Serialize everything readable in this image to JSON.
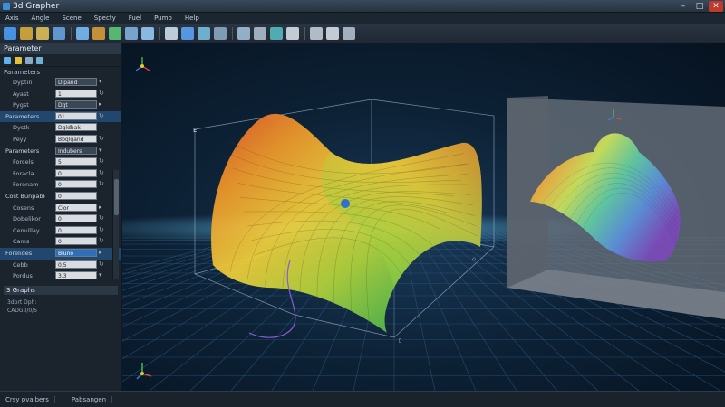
{
  "window": {
    "title": "3d Grapher"
  },
  "menu": [
    "Axis",
    "Angle",
    "Scene",
    "Specty",
    "Fuel",
    "Pump",
    "Help"
  ],
  "toolbar": {
    "tools": [
      {
        "icon": "new-file-icon",
        "color": "#4da3ff"
      },
      {
        "icon": "open-folder-icon",
        "color": "#e2b33c"
      },
      {
        "icon": "save-icon",
        "color": "#e8c85a"
      },
      {
        "icon": "copy-icon",
        "color": "#6aa9e8"
      },
      {
        "icon": "link-icon",
        "color": "#7fc3ff"
      },
      {
        "icon": "zoom-window-icon",
        "color": "#e3a13a"
      },
      {
        "icon": "draw-icon",
        "color": "#5fd07a"
      },
      {
        "icon": "rotate-icon",
        "color": "#86b9e8"
      },
      {
        "icon": "grab-icon",
        "color": "#9bd1ff"
      },
      {
        "icon": "zoom-icon",
        "color": "#d9e6f3"
      },
      {
        "icon": "arrow-down-icon",
        "color": "#5fa8ff"
      },
      {
        "icon": "layers-icon",
        "color": "#7cc6e8"
      },
      {
        "icon": "camera-icon",
        "color": "#8fb0c9"
      },
      {
        "icon": "grid-icon",
        "color": "#a7c7e0"
      },
      {
        "icon": "texture-icon",
        "color": "#b5c4d3"
      },
      {
        "icon": "triangle-icon",
        "color": "#58c2c8"
      },
      {
        "icon": "axes-icon",
        "color": "#dfe8f1"
      },
      {
        "icon": "compass-icon",
        "color": "#c9d5e0"
      },
      {
        "icon": "pointer-icon",
        "color": "#dfe8f1"
      },
      {
        "icon": "brush-icon",
        "color": "#b7c6d6"
      }
    ]
  },
  "panel": {
    "title": "Parameter",
    "section": "Parameters",
    "rows": [
      {
        "label": "Dyptin",
        "value": "Dlpand",
        "ctl": "▾",
        "style": "dark",
        "group": false,
        "hl": false
      },
      {
        "label": "Ayast",
        "value": "1",
        "ctl": "↻",
        "style": "light",
        "group": false,
        "hl": false
      },
      {
        "label": "Pygst",
        "value": "Dgt",
        "ctl": "▸",
        "style": "dark",
        "group": false,
        "hl": false
      },
      {
        "label": "Parameters",
        "value": "01",
        "ctl": "↻",
        "style": "light",
        "group": true,
        "hl": true
      },
      {
        "label": "Dystk",
        "value": "Dgldbak",
        "ctl": "",
        "style": "light",
        "group": false,
        "hl": false
      },
      {
        "label": "Peyy",
        "value": "Bbqlgand",
        "ctl": "↻",
        "style": "light",
        "group": false,
        "hl": false
      },
      {
        "label": "Parameters",
        "value": "Indubers",
        "ctl": "▾",
        "style": "dark",
        "group": true,
        "hl": false
      },
      {
        "label": "Forcels",
        "value": "5",
        "ctl": "↻",
        "style": "light",
        "group": false,
        "hl": false
      },
      {
        "label": "Foracla",
        "value": "0",
        "ctl": "↻",
        "style": "light",
        "group": false,
        "hl": false
      },
      {
        "label": "Forenam",
        "value": "0",
        "ctl": "↻",
        "style": "light",
        "group": false,
        "hl": false
      },
      {
        "label": "Cost Bunpable",
        "value": "0",
        "ctl": "",
        "style": "light",
        "group": true,
        "hl": false
      },
      {
        "label": "Cosens",
        "value": "Clor",
        "ctl": "▸",
        "style": "light",
        "group": false,
        "hl": false
      },
      {
        "label": "Dobelikor",
        "value": "0",
        "ctl": "↻",
        "style": "light",
        "group": false,
        "hl": false
      },
      {
        "label": "Cenvillay",
        "value": "0",
        "ctl": "↻",
        "style": "light",
        "group": false,
        "hl": false
      },
      {
        "label": "Cams",
        "value": "0",
        "ctl": "↻",
        "style": "light",
        "group": false,
        "hl": false
      },
      {
        "label": "Forelides",
        "value": "Bluno",
        "ctl": "▸",
        "style": "sel",
        "group": true,
        "hl": true
      },
      {
        "label": "Cebb",
        "value": "0.5",
        "ctl": "↻",
        "style": "light",
        "group": false,
        "hl": false
      },
      {
        "label": "Pordus",
        "value": "3.3",
        "ctl": "▾",
        "style": "light",
        "group": false,
        "hl": false
      }
    ],
    "sub_panel": {
      "title": "3 Graphs",
      "lines": [
        "3dprt  Dph:",
        "CADG0/0/5"
      ]
    }
  },
  "viewport": {
    "icons": [
      "axes-gizmo-icon",
      "axes-gizmo-icon",
      "axes-gizmo-icon"
    ],
    "surface_colors": [
      "#e8552a",
      "#f29b2a",
      "#f2d03a",
      "#b5d53a",
      "#5fbf4a",
      "#3aa67a"
    ],
    "inset_colors": [
      "#c93a3a",
      "#f2a03a",
      "#c9e05a",
      "#5fc9a0",
      "#5a8fd8",
      "#7a4ab8"
    ]
  },
  "status": [
    "Crsy pvalbers",
    "Pabsangen"
  ]
}
